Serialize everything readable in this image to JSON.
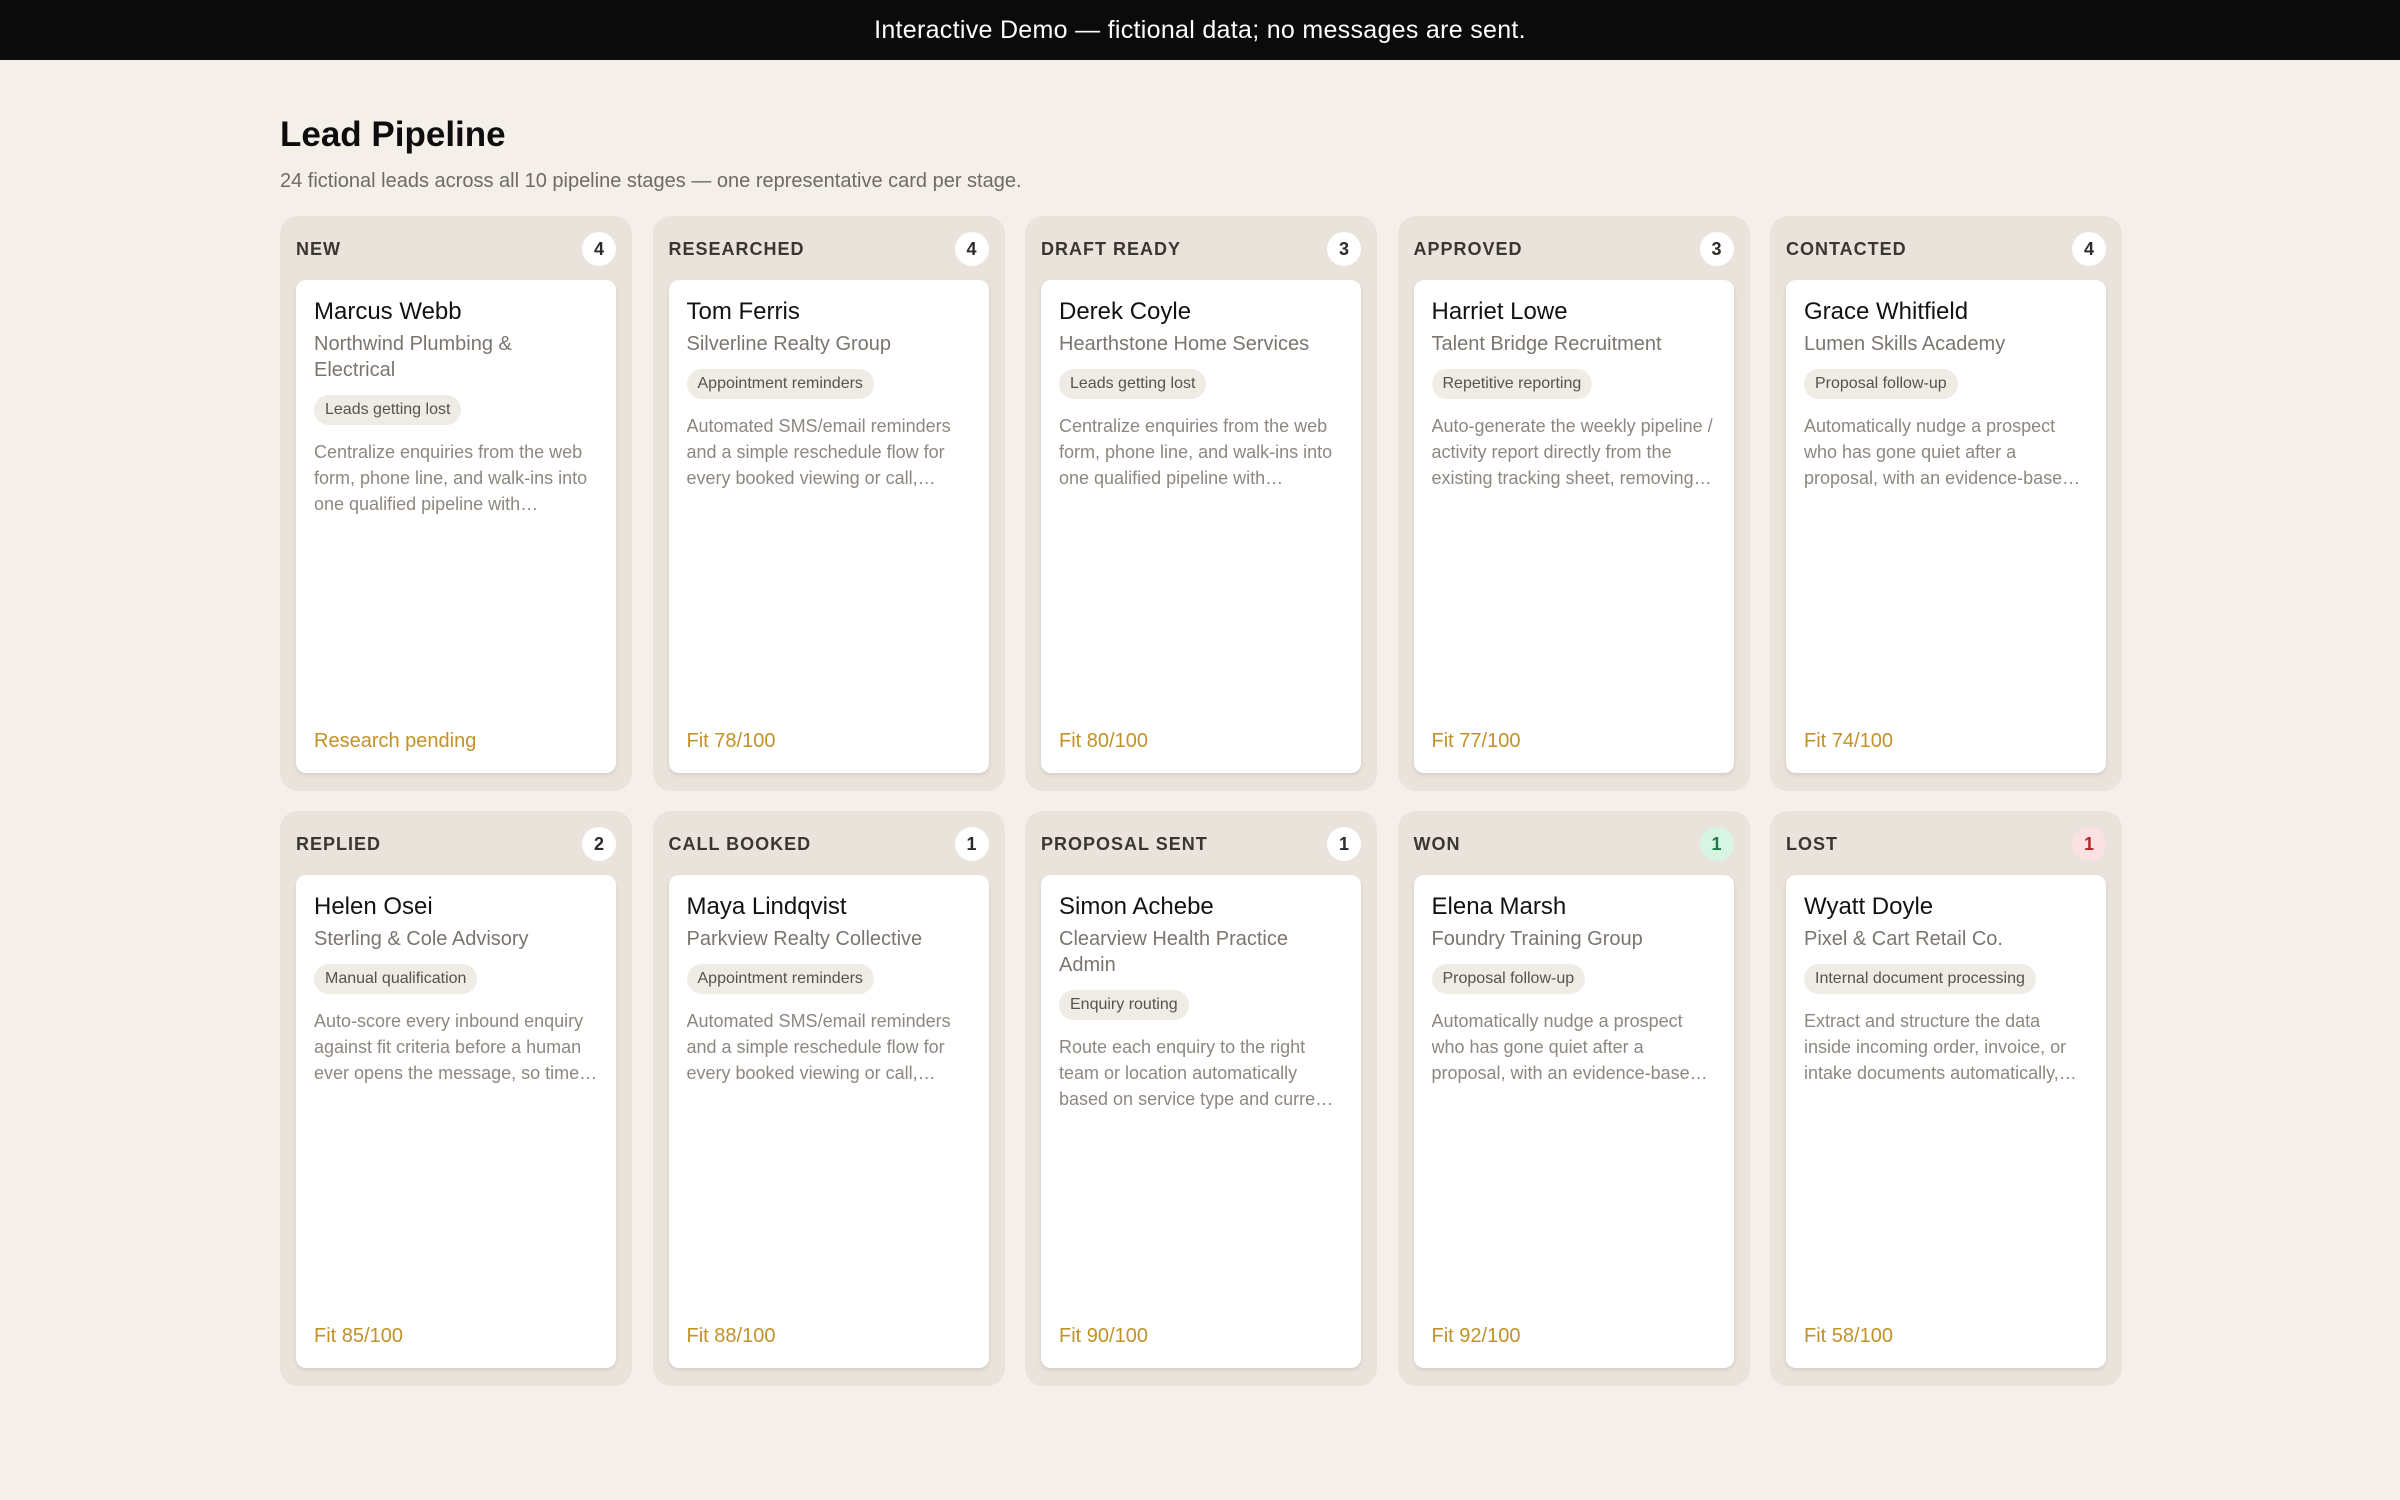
{
  "banner": {
    "text": "Interactive Demo — fictional data; no messages are sent."
  },
  "header": {
    "title": "Lead Pipeline",
    "subtitle": "24 fictional leads across all 10 pipeline stages — one representative card per stage."
  },
  "colors": {
    "background": "#f4efe8",
    "column_bg": "#e9e3db",
    "accent_fit": "#c2912a",
    "won_badge_bg": "#d6f5e3",
    "won_badge_text": "#1f7a45",
    "lost_badge_bg": "#fbe1e1",
    "lost_badge_text": "#b3262b"
  },
  "columns": [
    {
      "title": "NEW",
      "count": "4",
      "card": {
        "name": "Marcus Webb",
        "company": "Northwind Plumbing & Electrical",
        "tag": "Leads getting lost",
        "description": "Centralize enquiries from the web form, phone line, and walk-ins into one qualified pipeline with automatic triage and follow-up.",
        "fit": "Research pending"
      }
    },
    {
      "title": "RESEARCHED",
      "count": "4",
      "card": {
        "name": "Tom Ferris",
        "company": "Silverline Realty Group",
        "tag": "Appointment reminders",
        "description": "Automated SMS/email reminders and a simple reschedule flow for every booked viewing or call, reducing no-shows.",
        "fit": "Fit 78/100"
      }
    },
    {
      "title": "DRAFT READY",
      "count": "3",
      "card": {
        "name": "Derek Coyle",
        "company": "Hearthstone Home Services",
        "tag": "Leads getting lost",
        "description": "Centralize enquiries from the web form, phone line, and walk-ins into one qualified pipeline with automatic triage and follow-up.",
        "fit": "Fit 80/100"
      }
    },
    {
      "title": "APPROVED",
      "count": "3",
      "card": {
        "name": "Harriet Lowe",
        "company": "Talent Bridge Recruitment",
        "tag": "Repetitive reporting",
        "description": "Auto-generate the weekly pipeline / activity report directly from the existing tracking sheet, removing hours of manual work.",
        "fit": "Fit 77/100"
      }
    },
    {
      "title": "CONTACTED",
      "count": "4",
      "card": {
        "name": "Grace Whitfield",
        "company": "Lumen Skills Academy",
        "tag": "Proposal follow-up",
        "description": "Automatically nudge a prospect who has gone quiet after a proposal, with an evidence-based follow-up sequence.",
        "fit": "Fit 74/100"
      }
    },
    {
      "title": "REPLIED",
      "count": "2",
      "card": {
        "name": "Helen Osei",
        "company": "Sterling & Cole Advisory",
        "tag": "Manual qualification",
        "description": "Auto-score every inbound enquiry against fit criteria before a human ever opens the message, so time goes to the best leads.",
        "fit": "Fit 85/100"
      }
    },
    {
      "title": "CALL BOOKED",
      "count": "1",
      "card": {
        "name": "Maya Lindqvist",
        "company": "Parkview Realty Collective",
        "tag": "Appointment reminders",
        "description": "Automated SMS/email reminders and a simple reschedule flow for every booked viewing or call, reducing no-shows.",
        "fit": "Fit 88/100"
      }
    },
    {
      "title": "PROPOSAL SENT",
      "count": "1",
      "card": {
        "name": "Simon Achebe",
        "company": "Clearview Health Practice Admin",
        "tag": "Enquiry routing",
        "description": "Route each enquiry to the right team or location automatically based on service type and current availability.",
        "fit": "Fit 90/100"
      }
    },
    {
      "title": "WON",
      "count": "1",
      "card": {
        "name": "Elena Marsh",
        "company": "Foundry Training Group",
        "tag": "Proposal follow-up",
        "description": "Automatically nudge a prospect who has gone quiet after a proposal, with an evidence-based follow-up sequence.",
        "fit": "Fit 92/100"
      }
    },
    {
      "title": "LOST",
      "count": "1",
      "card": {
        "name": "Wyatt Doyle",
        "company": "Pixel & Cart Retail Co.",
        "tag": "Internal document processing",
        "description": "Extract and structure the data inside incoming order, invoice, or intake documents automatically, without retyping.",
        "fit": "Fit 58/100"
      }
    }
  ]
}
